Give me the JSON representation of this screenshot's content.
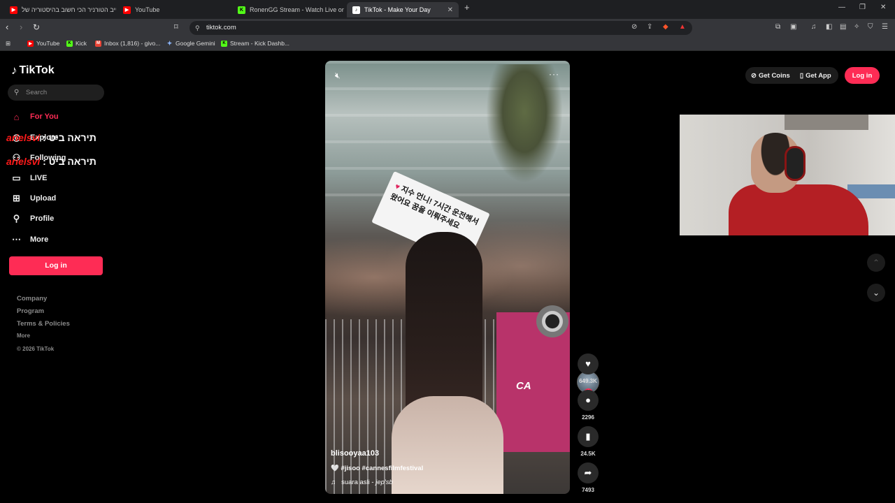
{
  "browser": {
    "tabs": [
      {
        "label": "לייב הטורניר הכי חשוב בהיסטוריה של",
        "fav": "YT",
        "fav_color": "#ff0000",
        "active": false
      },
      {
        "label": "YouTube",
        "fav": "YT",
        "fav_color": "#ff0000",
        "active": false
      },
      {
        "label": "RonenGG Stream - Watch Live on Kic",
        "fav": "K",
        "fav_color": "#53fc18",
        "active": false
      },
      {
        "label": "TikTok - Make Your Day",
        "fav": "♪",
        "fav_color": "#000000",
        "active": true
      }
    ],
    "new_tab": "+",
    "url": "tiktok.com",
    "bookmarks": [
      {
        "label": "YouTube",
        "fav": "▶",
        "fav_color": "#ff0000"
      },
      {
        "label": "Kick",
        "fav": "K",
        "fav_color": "#53fc18"
      },
      {
        "label": "Inbox (1,816) - givo...",
        "fav": "M",
        "fav_color": "#ea4335"
      },
      {
        "label": "Google Gemini",
        "fav": "✦",
        "fav_color": "#8ab4f8"
      },
      {
        "label": "Stream - Kick Dashb...",
        "fav": "K",
        "fav_color": "#53fc18"
      }
    ]
  },
  "sidebar": {
    "logo": "TikTok",
    "search_placeholder": "Search",
    "items": [
      {
        "label": "For You",
        "icon": "home-icon"
      },
      {
        "label": "Explore",
        "icon": "compass-icon"
      },
      {
        "label": "Following",
        "icon": "following-icon"
      },
      {
        "label": "LIVE",
        "icon": "live-icon"
      },
      {
        "label": "Upload",
        "icon": "upload-icon"
      },
      {
        "label": "Profile",
        "icon": "profile-icon"
      },
      {
        "label": "More",
        "icon": "more-icon"
      }
    ],
    "login": "Log in",
    "footer": [
      "Company",
      "Program",
      "Terms & Policies",
      "More",
      "© 2026 TikTok"
    ]
  },
  "overlay": {
    "user": "arielsvi",
    "separator": ":",
    "message": "תיראה ביט"
  },
  "video": {
    "author": "blisooyaa103",
    "caption": "🤍 #jisoo #cannesfilmfestival",
    "music_note": "♫",
    "music_title": "suara asli",
    "music_dash": " - ",
    "music_artist": "jep'sb",
    "sign_text": "지수 언니! 7시간 운전해서 왔어요 꿈을 이뤄주세요",
    "banner_text": "CA"
  },
  "actions": {
    "likes": "649.3K",
    "comments": "2296",
    "saves": "24.5K",
    "shares": "7493"
  },
  "header": {
    "get_coins": "Get Coins",
    "get_app": "Get App",
    "login": "Log in"
  },
  "colors": {
    "accent": "#fe2c55",
    "overlay_user": "#ff1a1a"
  }
}
